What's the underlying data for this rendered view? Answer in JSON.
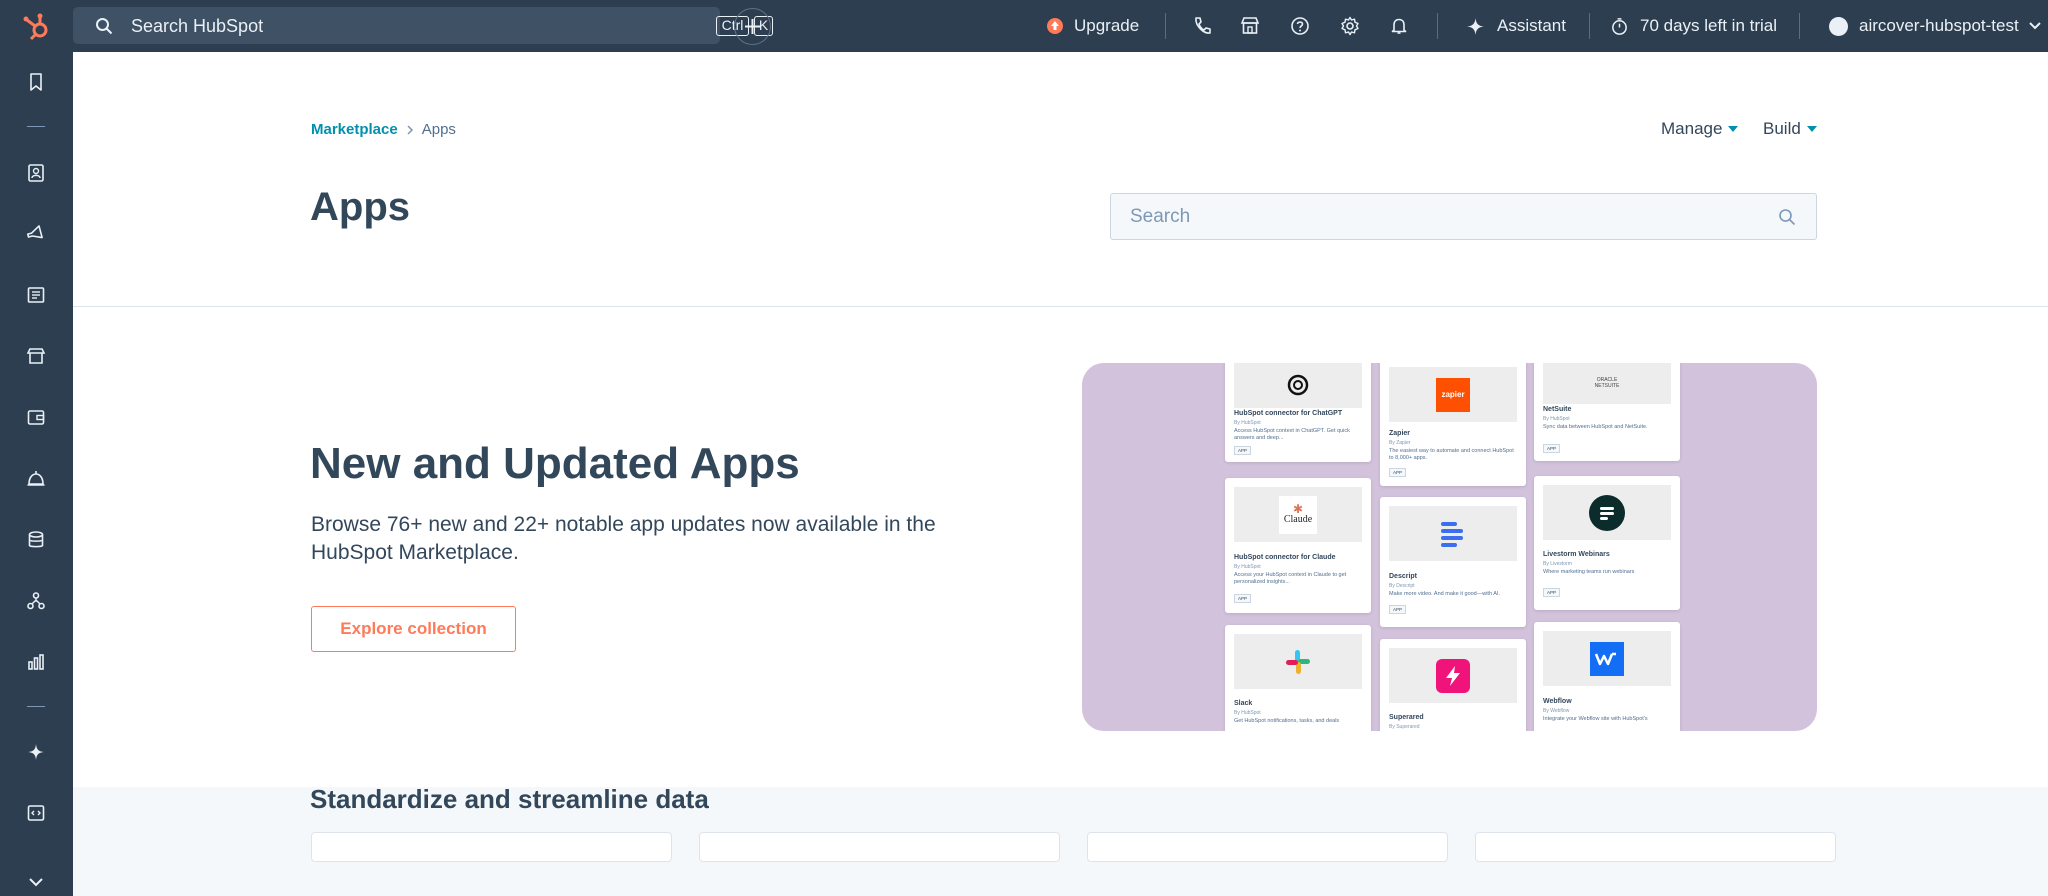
{
  "topbar": {
    "search_placeholder": "Search HubSpot",
    "shortcut_ctrl": "Ctrl",
    "shortcut_k": "K",
    "upgrade_label": "Upgrade",
    "assistant_label": "Assistant",
    "trial_label": "70 days left in trial",
    "account_name": "aircover-hubspot-test"
  },
  "breadcrumb": {
    "parent": "Marketplace",
    "current": "Apps"
  },
  "header": {
    "manage_label": "Manage",
    "build_label": "Build",
    "title": "Apps",
    "search_placeholder": "Search"
  },
  "hero": {
    "title": "New and Updated Apps",
    "description": "Browse 76+ new and 22+ notable app updates now available in the HubSpot Marketplace.",
    "button_label": "Explore collection",
    "cards": [
      {
        "name": "HubSpot connector for ChatGPT",
        "by": "By HubSpot",
        "desc": "Access HubSpot context in ChatGPT. Get quick answers and deep...",
        "tag": "APP",
        "logo": "openai-logo"
      },
      {
        "name": "Zapier",
        "by": "By Zapier",
        "desc": "The easiest way to automate and connect HubSpot to 8,000+ apps.",
        "tag": "APP",
        "logo_text": "zapier",
        "logo": "zapier-logo"
      },
      {
        "name": "NetSuite",
        "by": "By HubSpot",
        "desc": "Sync data between HubSpot and NetSuite.",
        "tag": "APP",
        "logo_text": "ORACLE NETSUITE",
        "logo": "netsuite-logo"
      },
      {
        "name": "HubSpot connector for Claude",
        "by": "By HubSpot",
        "desc": "Access your HubSpot context in Claude to get personalized insights...",
        "tag": "APP",
        "logo_text": "Claude",
        "logo": "claude-logo"
      },
      {
        "name": "Descript",
        "by": "By Descript",
        "desc": "Make more video. And make it good—with AI.",
        "tag": "APP",
        "logo": "descript-logo"
      },
      {
        "name": "Livestorm Webinars",
        "by": "By Livestorm",
        "desc": "Where marketing teams run webinars",
        "tag": "APP",
        "logo": "livestorm-logo"
      },
      {
        "name": "Slack",
        "by": "By HubSpot",
        "desc": "Get HubSpot notifications, tasks, and deals",
        "tag": "APP",
        "logo": "slack-logo"
      },
      {
        "name": "Superared",
        "by": "By Superared",
        "desc": "",
        "tag": "",
        "logo": "superared-logo"
      },
      {
        "name": "Webflow",
        "by": "By Webflow",
        "desc": "Integrate your Webflow site with HubSpot's",
        "tag": "",
        "logo": "webflow-logo"
      }
    ]
  },
  "section": {
    "title": "Standardize and streamline data"
  },
  "colors": {
    "nav_bg": "#2d3e50",
    "accent_orange": "#ff7a59",
    "link_teal": "#0091ae",
    "text_dark": "#33475b",
    "hero_bg": "#d3c2dc"
  }
}
